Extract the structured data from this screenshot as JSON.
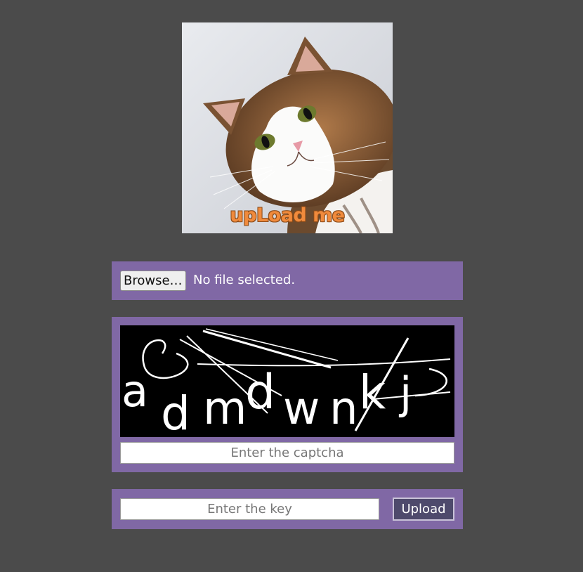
{
  "hero_image": {
    "caption": "upLoad me"
  },
  "file_picker": {
    "button_label": "Browse…",
    "status_text": "No file selected."
  },
  "captcha": {
    "text": "admdwnkj",
    "input_placeholder": "Enter the captcha"
  },
  "key_form": {
    "input_placeholder": "Enter the key",
    "submit_label": "Upload"
  },
  "colors": {
    "page_background": "#4b4b4b",
    "panel_background": "#8068a5",
    "upload_button": "#4e4a6c",
    "caption_orange": "#f08a3c"
  }
}
